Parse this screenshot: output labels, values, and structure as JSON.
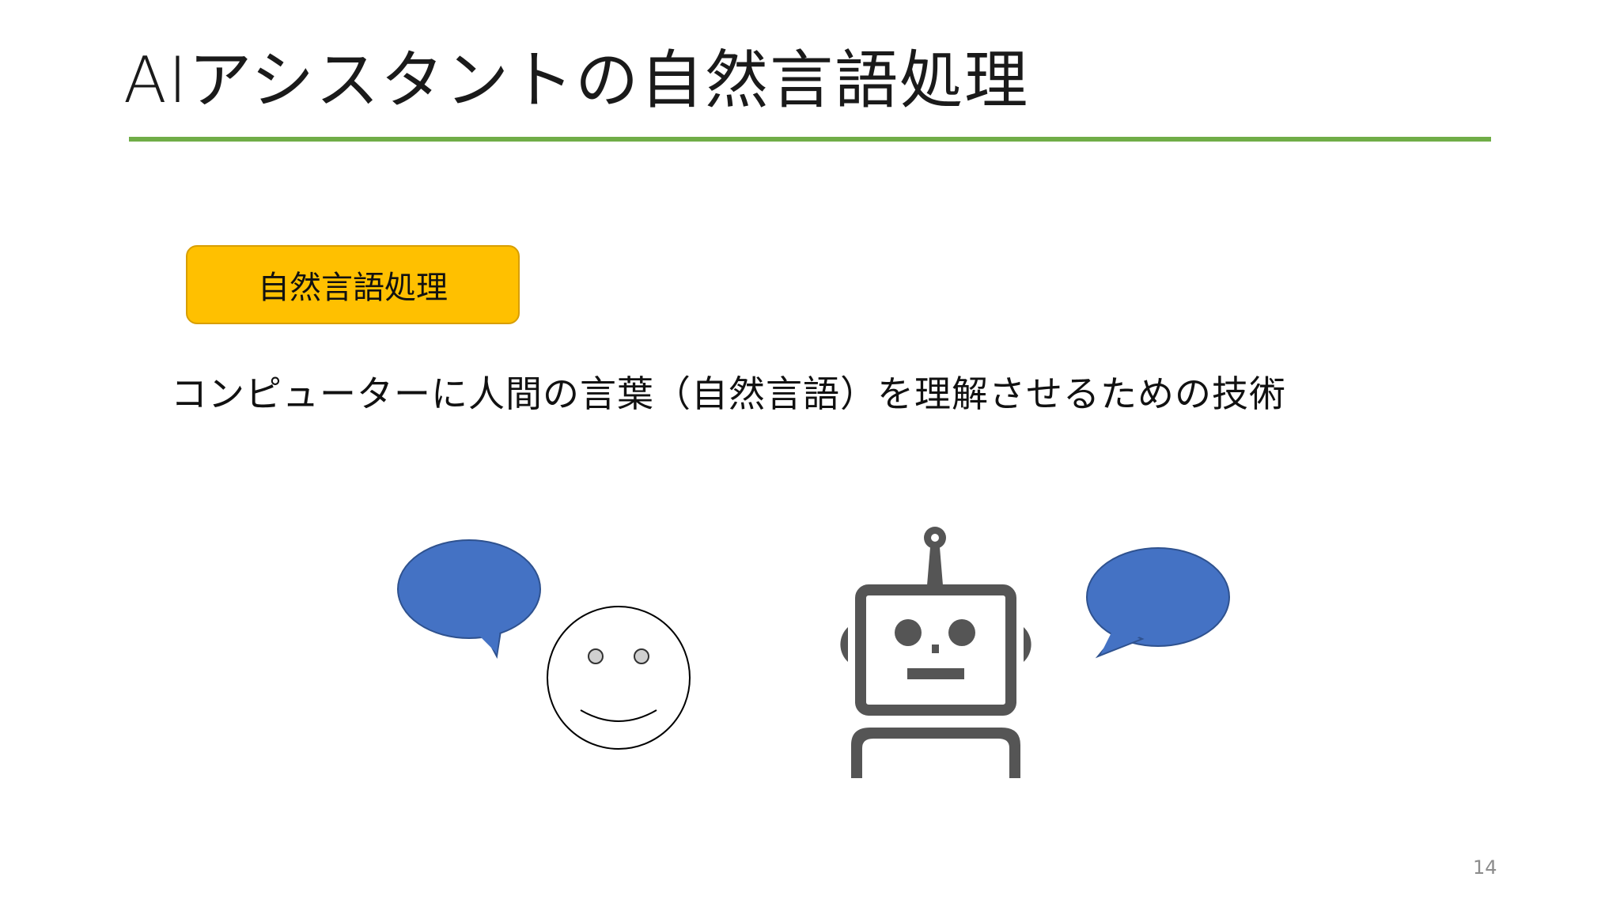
{
  "slide": {
    "title": "AIアシスタントの自然言語処理",
    "tag_label": "自然言語処理",
    "subtitle": "コンピューターに人間の言葉（自然言語）を理解させるための技術",
    "page_number": "14"
  },
  "colors": {
    "accent_rule": "#70ad47",
    "tag_fill": "#ffc000",
    "speech_bubble": "#4472c4",
    "robot": "#555555"
  },
  "icons": [
    "speech-bubble-icon",
    "smiley-face-icon",
    "robot-icon",
    "speech-bubble-icon"
  ]
}
